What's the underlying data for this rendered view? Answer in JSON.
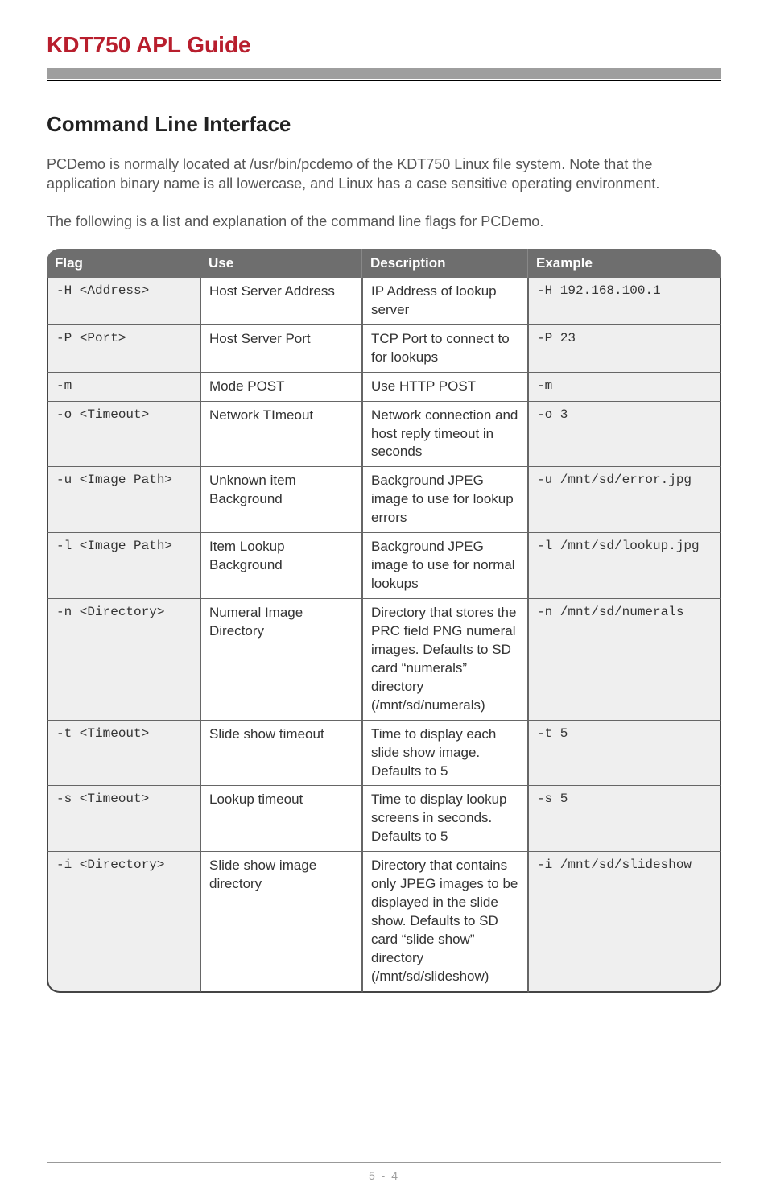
{
  "header": {
    "title": "KDT750 APL Guide"
  },
  "section": {
    "heading": "Command Line Interface",
    "para1": "PCDemo is normally located at /usr/bin/pcdemo of the KDT750 Linux file system. Note that the application binary name is all lowercase, and Linux has a case sensitive operating environment.",
    "para2": "The following is a list and explanation of the command line flags for PCDemo."
  },
  "table": {
    "headers": {
      "flag": "Flag",
      "use": "Use",
      "desc": "Description",
      "example": "Example"
    },
    "rows": [
      {
        "flag": "-H <Address>",
        "use": "Host Server Address",
        "desc": "IP Address of lookup server",
        "example": "-H 192.168.100.1"
      },
      {
        "flag": "-P <Port>",
        "use": "Host Server Port",
        "desc": "TCP Port to connect to for lookups",
        "example": "-P 23"
      },
      {
        "flag": "-m",
        "use": "Mode POST",
        "desc": "Use HTTP POST",
        "example": "-m"
      },
      {
        "flag": "-o <Timeout>",
        "use": "Network TImeout",
        "desc": "Network connection and host reply timeout in seconds",
        "example": "-o 3"
      },
      {
        "flag": "-u <Image Path>",
        "use": "Unknown item Background",
        "desc": "Background JPEG image to use for lookup errors",
        "example": "-u /mnt/sd/error.jpg"
      },
      {
        "flag": "-l <Image Path>",
        "use": "Item Lookup Background",
        "desc": "Background JPEG image to use for normal lookups",
        "example": "-l /mnt/sd/lookup.jpg"
      },
      {
        "flag": "-n <Directory>",
        "use": "Numeral Image Directory",
        "desc": "Directory that stores the PRC field PNG numeral images. Defaults to SD card “numerals” directory (/mnt/sd/numerals)",
        "example": "-n /mnt/sd/numerals"
      },
      {
        "flag": "-t <Timeout>",
        "use": "Slide show timeout",
        "desc": "Time to display each slide show image. Defaults to 5",
        "example": "-t 5"
      },
      {
        "flag": "-s <Timeout>",
        "use": "Lookup timeout",
        "desc": "Time to display lookup screens in seconds. Defaults to 5",
        "example": "-s 5"
      },
      {
        "flag": "-i <Directory>",
        "use": "Slide show image directory",
        "desc": "Directory that contains only JPEG images to be displayed in the slide show. Defaults to SD card “slide show” directory (/mnt/sd/slideshow)",
        "example": "-i /mnt/sd/slideshow"
      }
    ]
  },
  "footer": {
    "page": "5 - 4"
  }
}
